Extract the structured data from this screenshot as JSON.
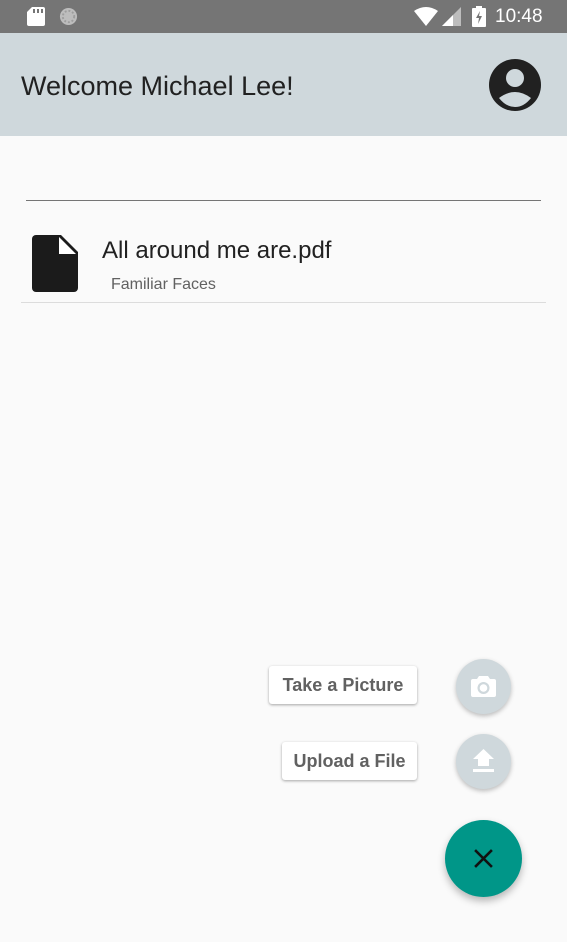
{
  "status_bar": {
    "time": "10:48",
    "icons": [
      "sd-card-icon",
      "sync-icon",
      "wifi-icon",
      "cell-signal-icon",
      "battery-charging-icon"
    ]
  },
  "app_bar": {
    "title": "Welcome Michael Lee!",
    "background_color": "#cfd8dc",
    "account_icon": "account-circle-icon"
  },
  "search": {
    "value": ""
  },
  "files": [
    {
      "name": "All around me are.pdf",
      "subtitle": "Familiar Faces",
      "icon": "file-icon"
    }
  ],
  "speed_dial": {
    "actions": [
      {
        "label": "Take a Picture",
        "icon": "camera-icon"
      },
      {
        "label": "Upload a File",
        "icon": "upload-icon"
      }
    ],
    "main_icon": "close-icon",
    "main_color": "#009688",
    "mini_color": "#cfd8dc"
  }
}
